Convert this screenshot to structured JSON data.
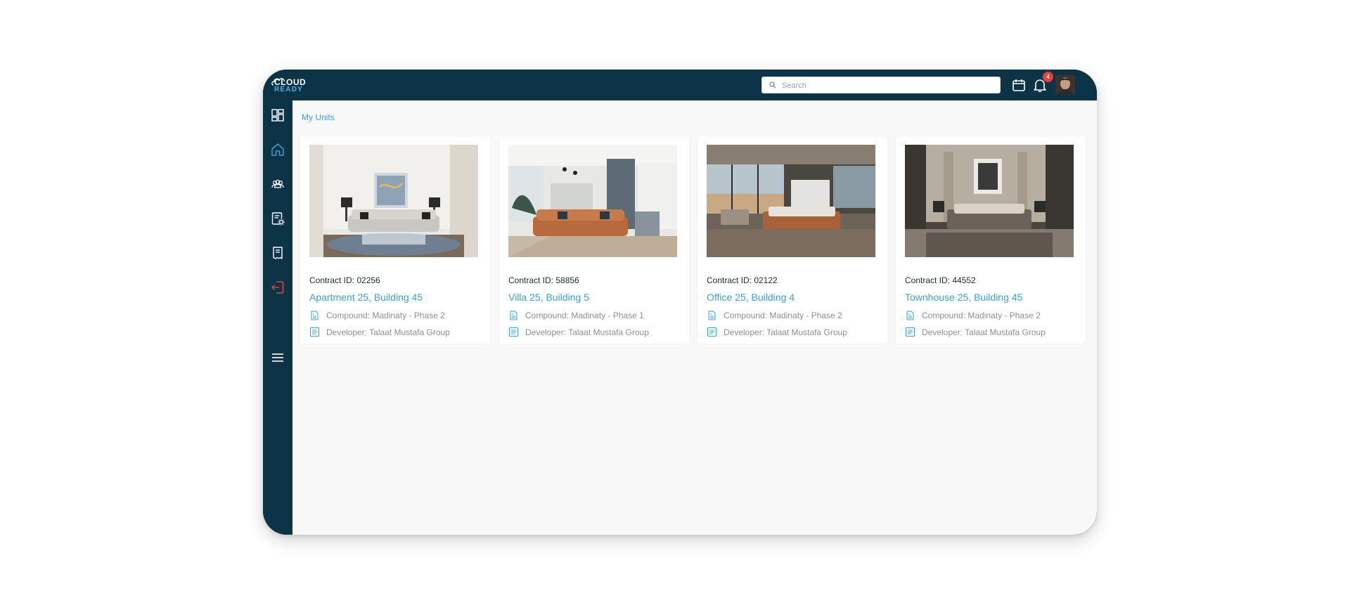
{
  "brand": {
    "logo_line1": "CLOUD",
    "logo_line2": "READY",
    "primary_color": "#0c3346",
    "accent_color": "#3d9fd2",
    "danger_color": "#e0453a"
  },
  "header": {
    "search": {
      "placeholder": "Search",
      "value": ""
    },
    "icons": [
      "calendar-icon",
      "bell-icon"
    ],
    "notification_count": "4",
    "avatar_icon": "user-avatar"
  },
  "sidebar": {
    "items": [
      {
        "icon": "dashboard-icon",
        "active": false
      },
      {
        "icon": "home-icon",
        "active": true
      },
      {
        "icon": "people-icon",
        "active": false
      },
      {
        "icon": "document-settings-icon",
        "active": false
      },
      {
        "icon": "receipt-icon",
        "active": false
      },
      {
        "icon": "logout-icon",
        "active": false
      },
      {
        "icon": "menu-icon",
        "active": false
      }
    ]
  },
  "main": {
    "breadcrumb": "My Units",
    "units": [
      {
        "contract": "Contract ID: 02256",
        "title": "Apartment 25, Building 45",
        "compound": "Compound: Madinaty - Phase 2",
        "developer": "Developer: Talaat Mustafa Group",
        "photo": "living-room-photo"
      },
      {
        "contract": "Contract ID: 58856",
        "title": "Villa 25, Building 5",
        "compound": "Compound: Madinaty - Phase 1",
        "developer": "Developer: Talaat Mustafa Group",
        "photo": "living-room-photo"
      },
      {
        "contract": "Contract ID: 02122",
        "title": "Office 25, Building 4",
        "compound": "Compound: Madinaty - Phase 2",
        "developer": "Developer: Talaat Mustafa Group",
        "photo": "bedroom-photo"
      },
      {
        "contract": "Contract ID: 44552",
        "title": "Townhouse 25, Building 45",
        "compound": "Compound: Madinaty - Phase 2",
        "developer": "Developer: Talaat Mustafa Group",
        "photo": "bedroom-photo"
      }
    ]
  }
}
